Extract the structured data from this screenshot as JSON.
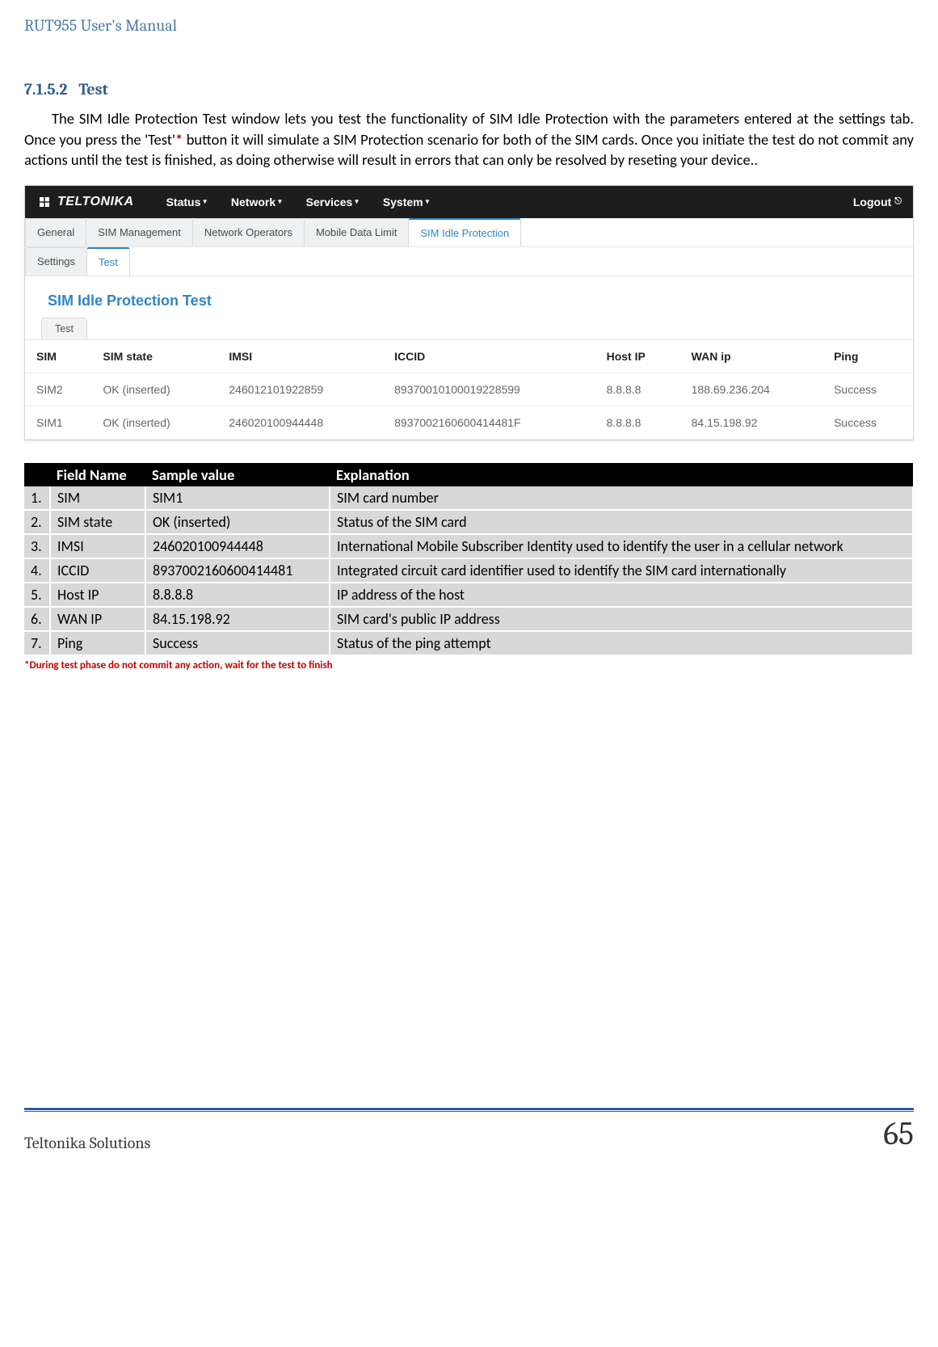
{
  "doc": {
    "header": "RUT955 User's Manual",
    "section_num": "7.1.5.2",
    "section_title": "Test",
    "para_before": "The SIM Idle Protection Test window lets you test the functionality of SIM Idle Protection with the parameters entered at the settings tab. Once you press the 'Test'",
    "para_after": " button it will simulate a SIM Protection scenario for both of the SIM cards. Once you initiate the test do not commit any actions until the test is finished, as doing otherwise will result in errors that can only be resolved by reseting your device..",
    "footnote": "*During test phase do not commit any action, wait for the test to finish",
    "footer_left": "Teltonika Solutions",
    "footer_right": "65"
  },
  "ui": {
    "brand": "TELTONIKA",
    "topnav": [
      "Status",
      "Network",
      "Services",
      "System"
    ],
    "logout": "Logout",
    "tabs": [
      "General",
      "SIM Management",
      "Network Operators",
      "Mobile Data Limit",
      "SIM Idle Protection"
    ],
    "active_tab_index": 4,
    "subtabs": [
      "Settings",
      "Test"
    ],
    "active_subtab_index": 1,
    "section_title": "SIM Idle Protection Test",
    "minitab": "Test",
    "table": {
      "headers": [
        "SIM",
        "SIM state",
        "IMSI",
        "ICCID",
        "Host IP",
        "WAN ip",
        "Ping"
      ],
      "rows": [
        {
          "sim": "SIM2",
          "state": "OK (inserted)",
          "imsi": "246012101922859",
          "iccid": "89370010100019228599",
          "host": "8.8.8.8",
          "wan": "188.69.236.204",
          "ping": "Success"
        },
        {
          "sim": "SIM1",
          "state": "OK (inserted)",
          "imsi": "246020100944448",
          "iccid": "8937002160600414481F",
          "host": "8.8.8.8",
          "wan": "84.15.198.92",
          "ping": "Success"
        }
      ]
    }
  },
  "explain": {
    "headers": [
      "",
      "Field Name",
      "Sample value",
      "Explanation"
    ],
    "rows": [
      {
        "n": "1.",
        "field": "SIM",
        "sample": "SIM1",
        "exp": "SIM card number"
      },
      {
        "n": "2.",
        "field": "SIM state",
        "sample": "OK (inserted)",
        "exp": "Status of the SIM card"
      },
      {
        "n": "3.",
        "field": "IMSI",
        "sample": "246020100944448",
        "exp": "International Mobile Subscriber Identity used to identify the user in a cellular network"
      },
      {
        "n": "4.",
        "field": "ICCID",
        "sample": "8937002160600414481",
        "exp": "Integrated circuit card identifier used to identify the SIM card internationally"
      },
      {
        "n": "5.",
        "field": "Host IP",
        "sample": "8.8.8.8",
        "exp": "IP address of the host"
      },
      {
        "n": "6.",
        "field": "WAN IP",
        "sample": "84.15.198.92",
        "exp": "SIM card's public IP address"
      },
      {
        "n": "7.",
        "field": "Ping",
        "sample": "Success",
        "exp": "Status of the ping attempt"
      }
    ]
  }
}
